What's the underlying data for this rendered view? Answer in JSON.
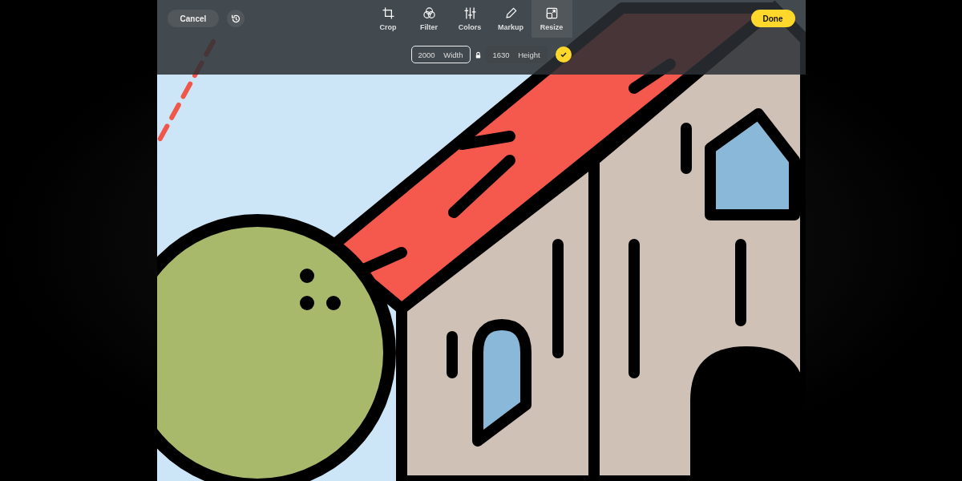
{
  "cancel_button": {
    "label": "Cancel"
  },
  "tools": [
    {
      "label": "Crop",
      "kind": "crop",
      "selected": false
    },
    {
      "label": "Filter",
      "kind": "filter",
      "selected": false
    },
    {
      "label": "Colors",
      "kind": "colors",
      "selected": false
    },
    {
      "label": "Markup",
      "kind": "markup",
      "selected": false
    },
    {
      "label": "Resize",
      "kind": "resize",
      "selected": true
    }
  ],
  "done_button": {
    "label": "Done"
  },
  "size_fields": [
    {
      "value": "2000",
      "label": "Width",
      "focused": true
    },
    {
      "value": "1630",
      "label": "Height",
      "focused": false
    }
  ]
}
